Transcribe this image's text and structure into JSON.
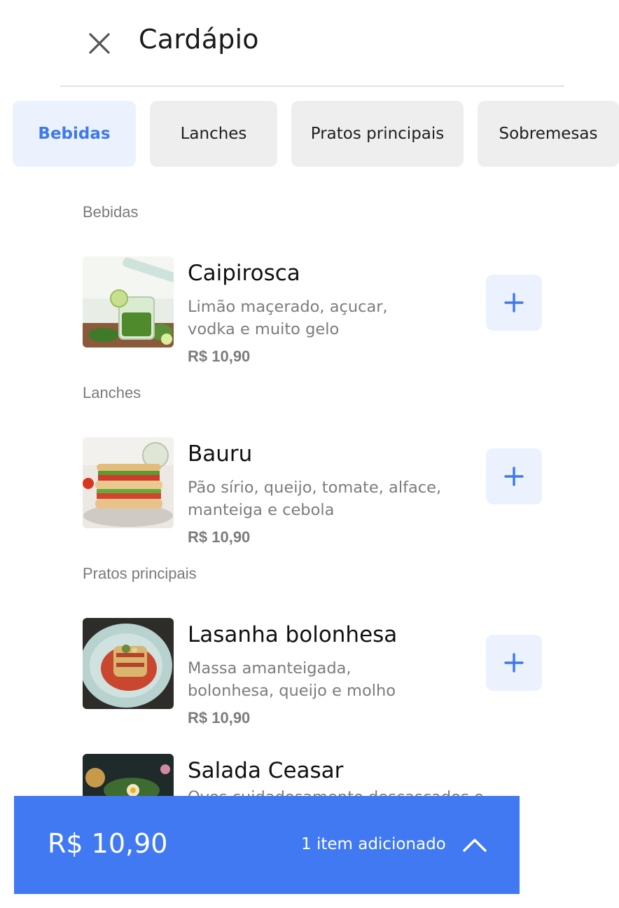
{
  "header": {
    "title": "Cardápio",
    "close_icon": "close-icon"
  },
  "tabs": [
    {
      "label": "Bebidas",
      "active": true
    },
    {
      "label": "Lanches",
      "active": false
    },
    {
      "label": "Pratos principais",
      "active": false
    },
    {
      "label": "Sobremesas",
      "active": false
    }
  ],
  "sections": [
    {
      "label": "Bebidas",
      "items": [
        {
          "name": "Caipirosca",
          "description": "Limão maçerado, açucar, vodka e muito gelo",
          "price": "R$ 10,90"
        }
      ]
    },
    {
      "label": "Lanches",
      "items": [
        {
          "name": "Bauru",
          "description": "Pão sírio, queijo, tomate, alface, manteiga e cebola",
          "price": "R$ 10,90"
        }
      ]
    },
    {
      "label": "Pratos principais",
      "items": [
        {
          "name": "Lasanha bolonhesa",
          "description": "Massa amanteigada, bolonhesa, queijo e molho",
          "price": "R$ 10,90"
        },
        {
          "name": "Salada Ceasar",
          "description": "Ovos cuidadosamente descascados e",
          "price": ""
        }
      ]
    }
  ],
  "cart": {
    "total": "R$ 10,90",
    "count_label": "1 item adicionado",
    "chevron_icon": "chevron-up-icon"
  },
  "colors": {
    "accent": "#4079f2",
    "tab_active_text": "#3e79ec",
    "tab_active_bg": "#ebf2fe",
    "tab_bg": "#eeeeee"
  }
}
